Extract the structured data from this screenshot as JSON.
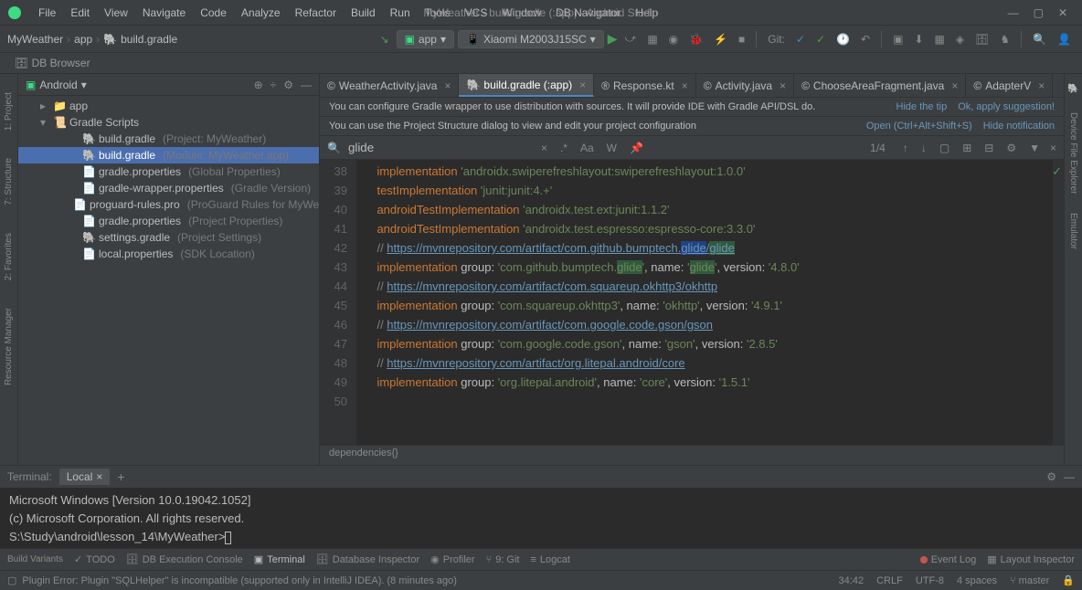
{
  "window": {
    "title": "MyWeather - build.gradle (:app) - Android Studio"
  },
  "menu": [
    "File",
    "Edit",
    "View",
    "Navigate",
    "Code",
    "Analyze",
    "Refactor",
    "Build",
    "Run",
    "Tools",
    "VCS",
    "Window",
    "DB Navigator",
    "Help"
  ],
  "breadcrumb": {
    "project": "MyWeather",
    "module": "app",
    "file": "build.gradle"
  },
  "toolbar": {
    "config": "app",
    "device": "Xiaomi M2003J15SC",
    "git": "Git:"
  },
  "dbBrowser": "DB Browser",
  "projectPanel": {
    "view": "Android",
    "items": [
      {
        "chev": "▸",
        "icon": "📁",
        "label": "app",
        "indent": 1
      },
      {
        "chev": "▾",
        "icon": "📜",
        "label": "Gradle Scripts",
        "indent": 1
      },
      {
        "chev": "",
        "icon": "🐘",
        "label": "build.gradle",
        "hint": "(Project: MyWeather)",
        "indent": 2
      },
      {
        "chev": "",
        "icon": "🐘",
        "label": "build.gradle",
        "hint": "(Module: MyWeather.app)",
        "indent": 2,
        "selected": true
      },
      {
        "chev": "",
        "icon": "📄",
        "label": "gradle.properties",
        "hint": "(Global Properties)",
        "indent": 2
      },
      {
        "chev": "",
        "icon": "📄",
        "label": "gradle-wrapper.properties",
        "hint": "(Gradle Version)",
        "indent": 2
      },
      {
        "chev": "",
        "icon": "📄",
        "label": "proguard-rules.pro",
        "hint": "(ProGuard Rules for MyWeather)",
        "indent": 2
      },
      {
        "chev": "",
        "icon": "📄",
        "label": "gradle.properties",
        "hint": "(Project Properties)",
        "indent": 2
      },
      {
        "chev": "",
        "icon": "🐘",
        "label": "settings.gradle",
        "hint": "(Project Settings)",
        "indent": 2
      },
      {
        "chev": "",
        "icon": "📄",
        "label": "local.properties",
        "hint": "(SDK Location)",
        "indent": 2
      }
    ]
  },
  "leftGutter": [
    "1: Project",
    "7: Structure",
    "2: Favorites",
    "Resource Manager",
    "Build Variants"
  ],
  "rightGutter": [
    "Gradle",
    "Device File Explorer",
    "Emulator"
  ],
  "editorTabs": [
    {
      "icon": "©",
      "label": "WeatherActivity.java"
    },
    {
      "icon": "🐘",
      "label": "build.gradle (:app)",
      "active": true
    },
    {
      "icon": "®",
      "label": "Response.kt"
    },
    {
      "icon": "©",
      "label": "Activity.java"
    },
    {
      "icon": "©",
      "label": "ChooseAreaFragment.java"
    },
    {
      "icon": "©",
      "label": "AdapterV"
    }
  ],
  "banner1": {
    "text": "You can configure Gradle wrapper to use distribution with sources. It will provide IDE with Gradle API/DSL do.",
    "link1": "Hide the tip",
    "link2": "Ok, apply suggestion!"
  },
  "banner2": {
    "text": "You can use the Project Structure dialog to view and edit your project configuration",
    "link1": "Open (Ctrl+Alt+Shift+S)",
    "link2": "Hide notification"
  },
  "search": {
    "value": "glide",
    "count": "1/4"
  },
  "codeLines": [
    38,
    39,
    40,
    41,
    42,
    43,
    44,
    45,
    46,
    47,
    48,
    49,
    50
  ],
  "code": {
    "l38": {
      "kw": "implementation",
      "str": "'androidx.swiperefreshlayout:swiperefreshlayout:1.0.0'"
    },
    "l39": {
      "kw": "testImplementation",
      "str": "'junit:junit:4.+'"
    },
    "l40": {
      "kw": "androidTestImplementation",
      "str": "'androidx.test.ext:junit:1.1.2'"
    },
    "l41": {
      "kw": "androidTestImplementation",
      "str": "'androidx.test.espresso:espresso-core:3.3.0'"
    },
    "l42": {
      "cmt": "// ",
      "url": "https://mvnrepository.com/artifact/com.github.bumptech.",
      "hl": "glide",
      "sep": "/",
      "hl2": "glide"
    },
    "l43": {
      "kw": "implementation",
      "a": " group: ",
      "s1": "'com.github.bumptech.",
      "hl": "glide",
      "s1b": "'",
      "b": ", name: ",
      "s2a": "'",
      "hl2": "glide",
      "s2b": "'",
      "c": ", version: ",
      "s3": "'4.8.0'"
    },
    "l44": {
      "cmt": "// ",
      "url": "https://mvnrepository.com/artifact/com.squareup.okhttp3/okhttp"
    },
    "l45": {
      "kw": "implementation",
      "a": " group: ",
      "s1": "'com.squareup.okhttp3'",
      "b": ", name: ",
      "s2": "'okhttp'",
      "c": ", version: ",
      "s3": "'4.9.1'"
    },
    "l46": {
      "cmt": "// ",
      "url": "https://mvnrepository.com/artifact/com.google.code.gson/gson"
    },
    "l47": {
      "kw": "implementation",
      "a": " group: ",
      "s1": "'com.google.code.gson'",
      "b": ", name: ",
      "s2": "'gson'",
      "c": ", version: ",
      "s3": "'2.8.5'"
    },
    "l48": {
      "cmt": "// ",
      "url": "https://mvnrepository.com/artifact/org.litepal.android/core"
    },
    "l49": {
      "kw": "implementation",
      "a": " group: ",
      "s1": "'org.litepal.android'",
      "b": ", name: ",
      "s2": "'core'",
      "c": ", version: ",
      "s3": "'1.5.1'"
    }
  },
  "breadcrumbBar": "dependencies{}",
  "terminal": {
    "label": "Terminal:",
    "tab": "Local",
    "line1": "Microsoft Windows [Version 10.0.19042.1052]",
    "line2": "(c) Microsoft Corporation. All rights reserved.",
    "prompt": "S:\\Study\\android\\lesson_14\\MyWeather>"
  },
  "bottomBar": {
    "items": [
      "TODO",
      "DB Execution Console",
      "Terminal",
      "Database Inspector",
      "Profiler",
      "9: Git",
      "Logcat"
    ],
    "right": [
      "Event Log",
      "Layout Inspector"
    ]
  },
  "statusBar": {
    "msg": "Plugin Error: Plugin \"SQLHelper\" is incompatible (supported only in IntelliJ IDEA). (8 minutes ago)",
    "pos": "34:42",
    "eol": "CRLF",
    "enc": "UTF-8",
    "indent": "4 spaces",
    "branch": "master"
  }
}
